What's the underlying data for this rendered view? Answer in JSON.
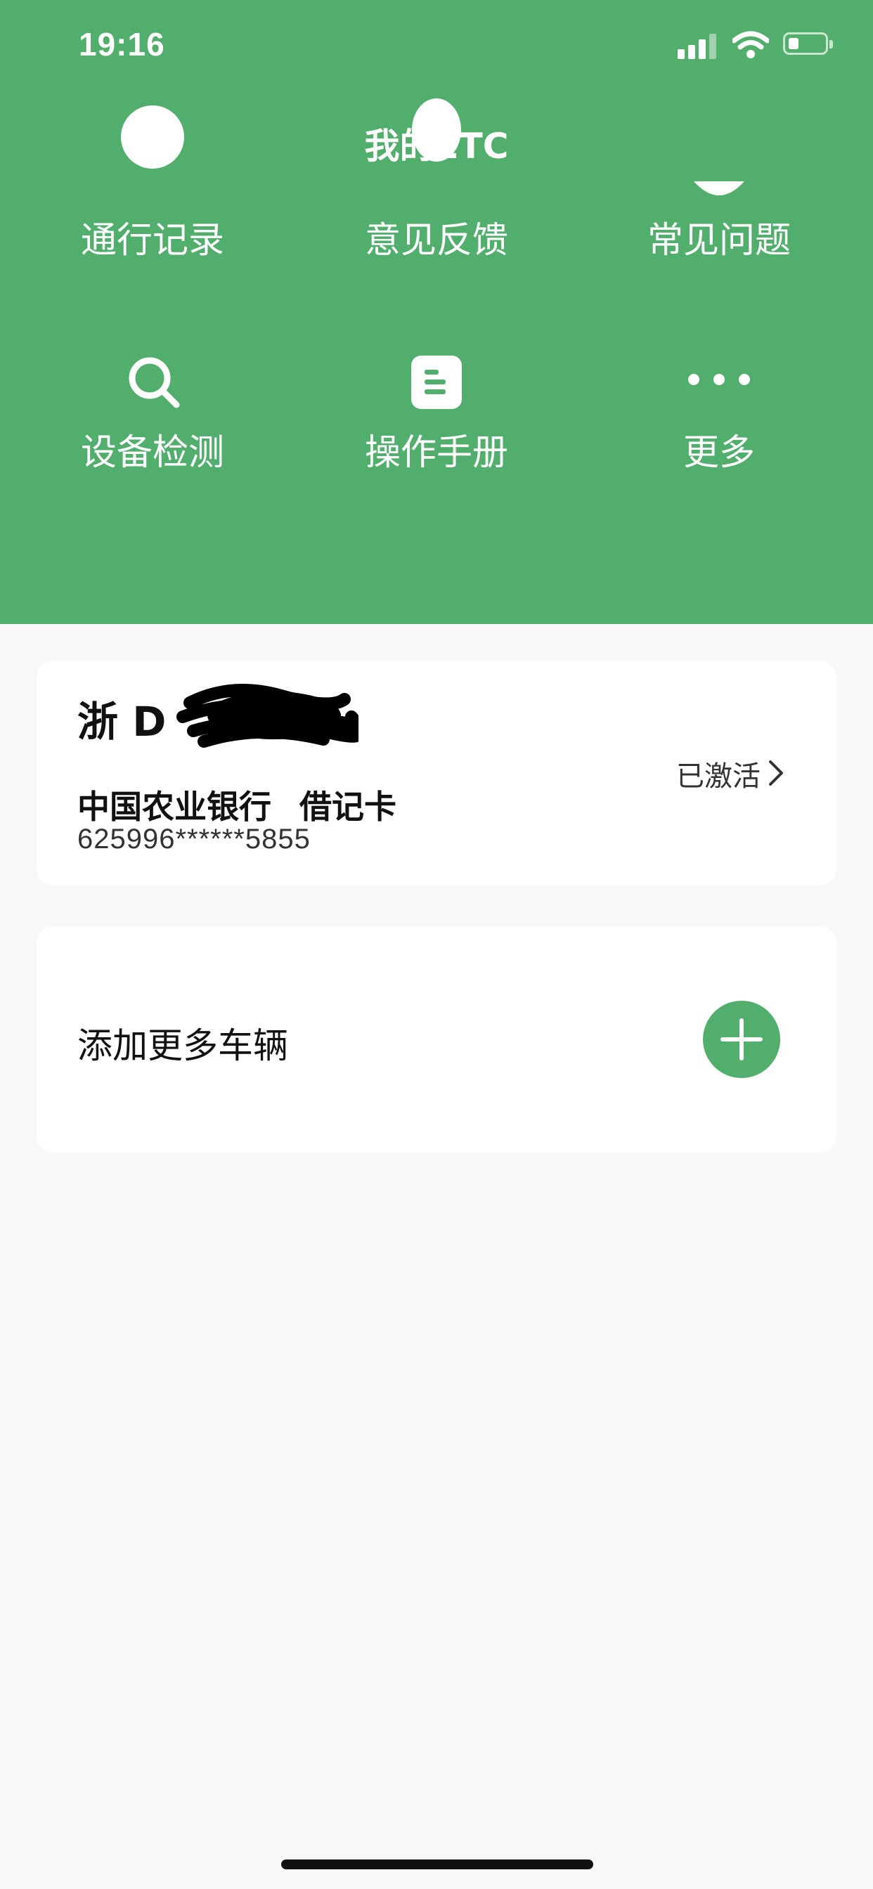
{
  "status_bar": {
    "time": "19:16"
  },
  "header": {
    "title": "我的ETC",
    "grid": [
      {
        "label": "通行记录",
        "icon": "partial-circle-icon"
      },
      {
        "label": "意见反馈",
        "icon": "partial-circle-icon"
      },
      {
        "label": "常见问题",
        "icon": "partial-chat-icon"
      },
      {
        "label": "设备检测",
        "icon": "search-icon"
      },
      {
        "label": "操作手册",
        "icon": "document-icon"
      },
      {
        "label": "更多",
        "icon": "more-dots-icon"
      }
    ]
  },
  "vehicle_card": {
    "plate": "浙 D",
    "bank": "中国农业银行",
    "card_type": "借记卡",
    "card_number": "625996******5855",
    "status": "已激活"
  },
  "add_card": {
    "label": "添加更多车辆"
  },
  "colors": {
    "primary": "#52ae6c",
    "background": "#f8f8f8"
  }
}
